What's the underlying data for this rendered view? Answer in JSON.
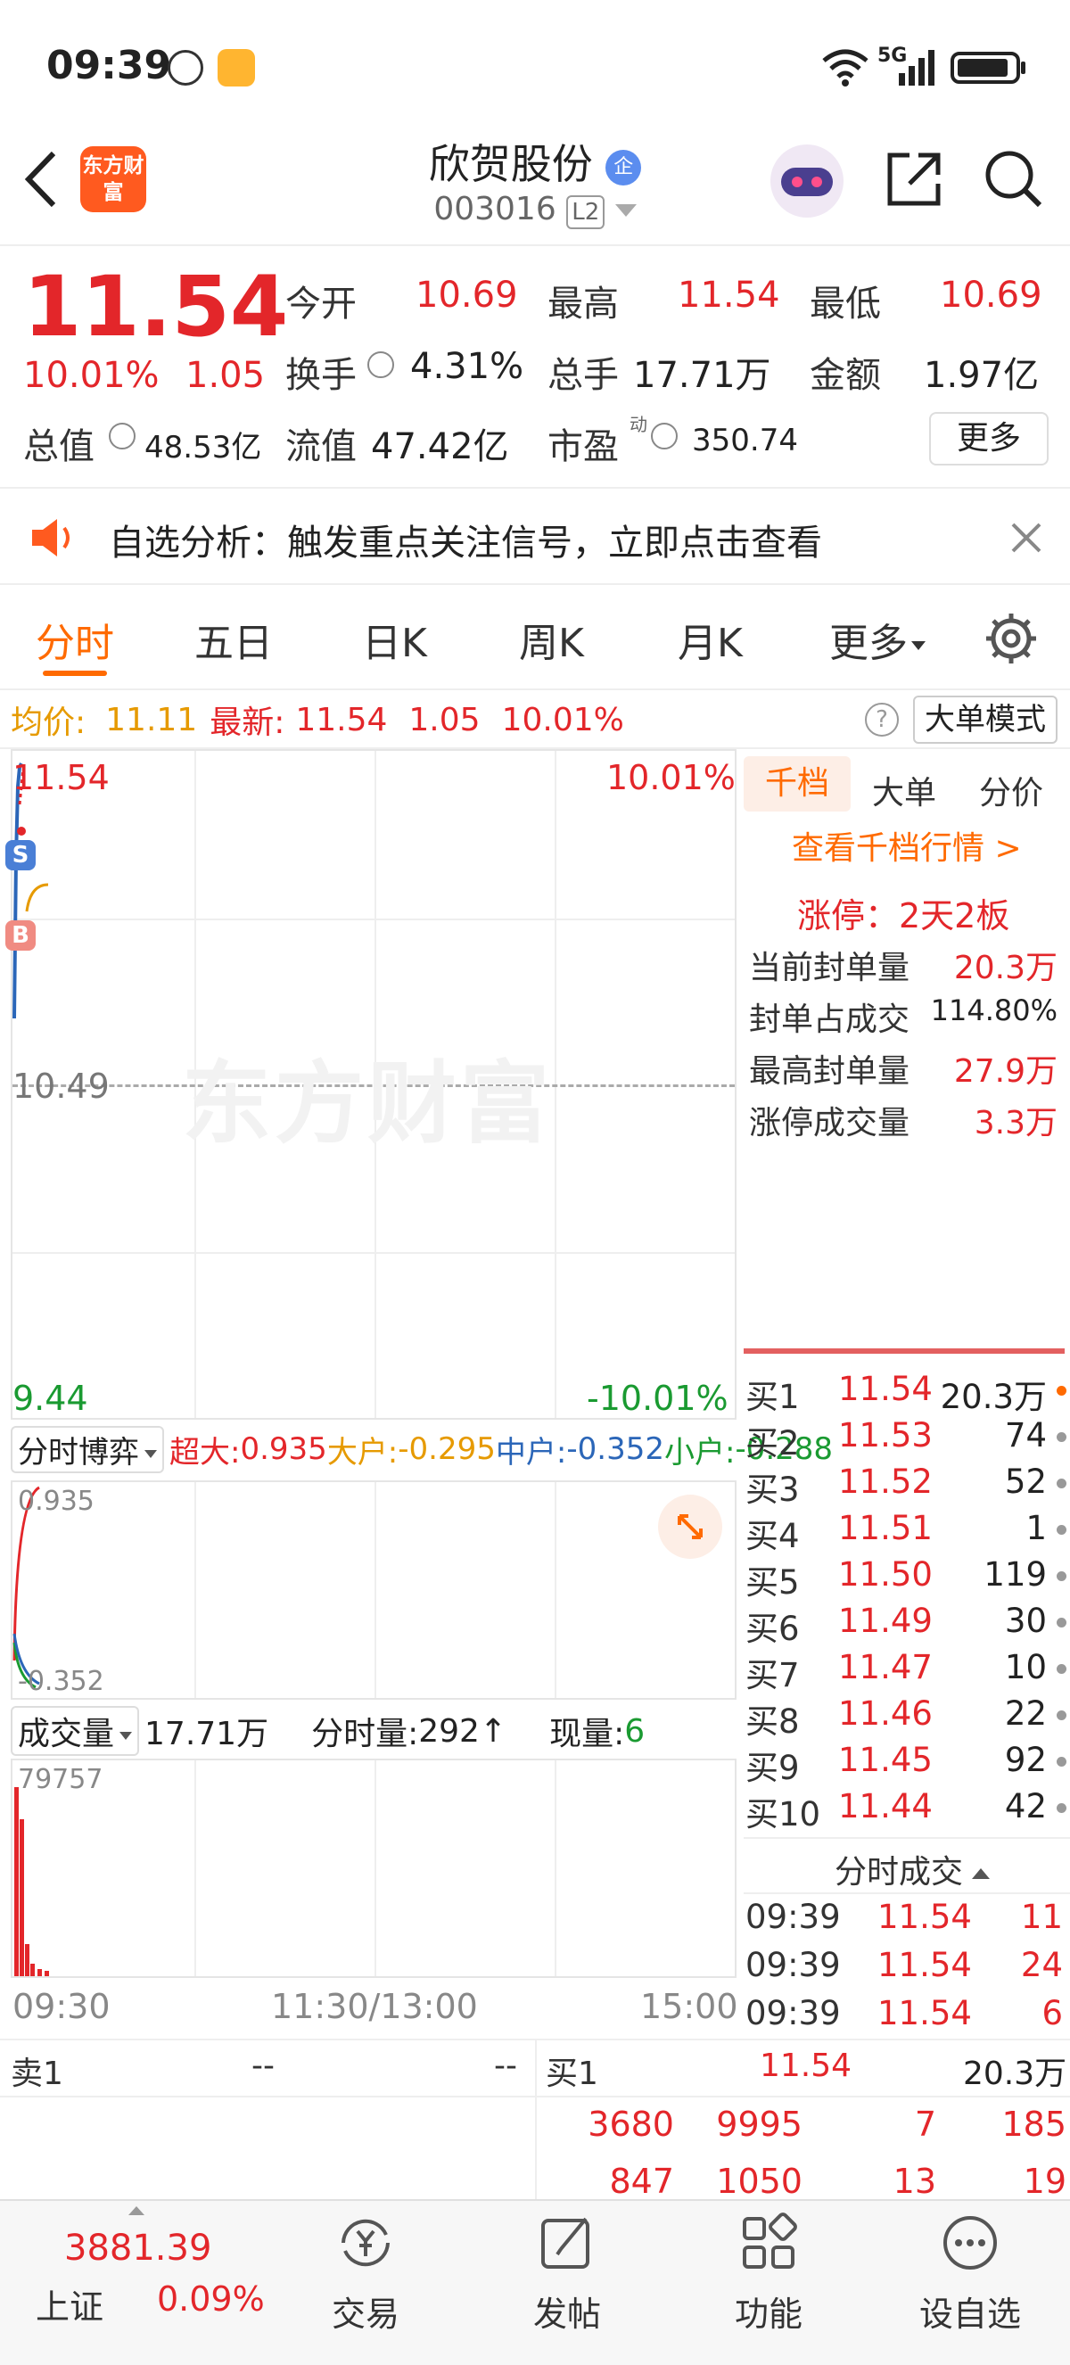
{
  "status": {
    "time": "09:39",
    "network": "5G"
  },
  "header": {
    "logo": "东方财富",
    "stock_name": "欣贺股份",
    "badge": "企",
    "code": "003016",
    "level": "L2"
  },
  "quote": {
    "price": "11.54",
    "change_pct": "10.01%",
    "change": "1.05",
    "open_label": "今开",
    "open": "10.69",
    "high_label": "最高",
    "high": "11.54",
    "low_label": "最低",
    "low": "10.69",
    "turnover_label": "换手",
    "turnover": "4.31%",
    "volume_label": "总手",
    "volume": "17.71万",
    "amount_label": "金额",
    "amount": "1.97亿",
    "mktcap_label": "总值",
    "mktcap": "48.53亿",
    "float_label": "流值",
    "float": "47.42亿",
    "pe_label": "市盈",
    "pe_sup": "动",
    "pe": "350.74",
    "more_button": "更多"
  },
  "banner": {
    "text": "自选分析：触发重点关注信号，立即点击查看"
  },
  "tabs": [
    "分时",
    "五日",
    "日K",
    "周K",
    "月K",
    "更多"
  ],
  "infobar": {
    "avg_label": "均价:",
    "avg": "11.11",
    "latest_label": "最新:",
    "latest": "11.54",
    "change": "1.05",
    "pct": "10.01%",
    "big_order_button": "大单模式"
  },
  "chart": {
    "top_price": "11.54",
    "top_pct": "10.01%",
    "mid_price": "10.49",
    "bottom_price": "9.44",
    "bottom_pct": "-10.01%",
    "watermark": "东方财富",
    "marker_s": "S",
    "marker_b": "B"
  },
  "game": {
    "selector": "分时博弈",
    "super_label": "超大:",
    "super": "0.935",
    "large_label": "大户:",
    "large": "-0.295",
    "mid_label": "中户:",
    "mid": "-0.352",
    "small_label": "小户:",
    "small": "-0.288",
    "axis_top": "0.935",
    "axis_bottom": "-0.352"
  },
  "vol": {
    "selector": "成交量",
    "total": "17.71万",
    "tick_label": "分时量:",
    "tick": "292",
    "now_label": "现量:",
    "now": "6",
    "axis_top": "79757"
  },
  "time_axis": [
    "09:30",
    "11:30/13:00",
    "15:00"
  ],
  "right_panel": {
    "tabs": [
      "千档",
      "大单",
      "分价"
    ],
    "link": "查看千档行情 >",
    "limit_title": "涨停：2天2板",
    "stats": [
      {
        "label": "当前封单量",
        "value": "20.3万"
      },
      {
        "label": "封单占成交",
        "value": "114.80%"
      },
      {
        "label": "最高封单量",
        "value": "27.9万"
      },
      {
        "label": "涨停成交量",
        "value": "3.3万"
      }
    ],
    "bids": [
      {
        "label": "买1",
        "price": "11.54",
        "vol": "20.3万"
      },
      {
        "label": "买2",
        "price": "11.53",
        "vol": "74"
      },
      {
        "label": "买3",
        "price": "11.52",
        "vol": "52"
      },
      {
        "label": "买4",
        "price": "11.51",
        "vol": "1"
      },
      {
        "label": "买5",
        "price": "11.50",
        "vol": "119"
      },
      {
        "label": "买6",
        "price": "11.49",
        "vol": "30"
      },
      {
        "label": "买7",
        "price": "11.47",
        "vol": "10"
      },
      {
        "label": "买8",
        "price": "11.46",
        "vol": "22"
      },
      {
        "label": "买9",
        "price": "11.45",
        "vol": "92"
      },
      {
        "label": "买10",
        "price": "11.44",
        "vol": "42"
      }
    ],
    "ticks_title": "分时成交",
    "ticks": [
      {
        "time": "09:39",
        "price": "11.54",
        "vol": "11"
      },
      {
        "time": "09:39",
        "price": "11.54",
        "vol": "24"
      },
      {
        "time": "09:39",
        "price": "11.54",
        "vol": "6"
      }
    ]
  },
  "queue": {
    "sell_label": "卖1",
    "sell_price": "--",
    "sell_vol": "--",
    "buy_label": "买1",
    "buy_price": "11.54",
    "buy_vol": "20.3万",
    "rows": [
      [
        "3680",
        "9995",
        "7",
        "185"
      ],
      [
        "847",
        "1050",
        "13",
        "19"
      ]
    ]
  },
  "bottom": {
    "index_value": "3881.39",
    "index_name": "上证",
    "index_pct": "0.09%",
    "tabs": [
      "交易",
      "发帖",
      "功能",
      "设自选"
    ]
  }
}
